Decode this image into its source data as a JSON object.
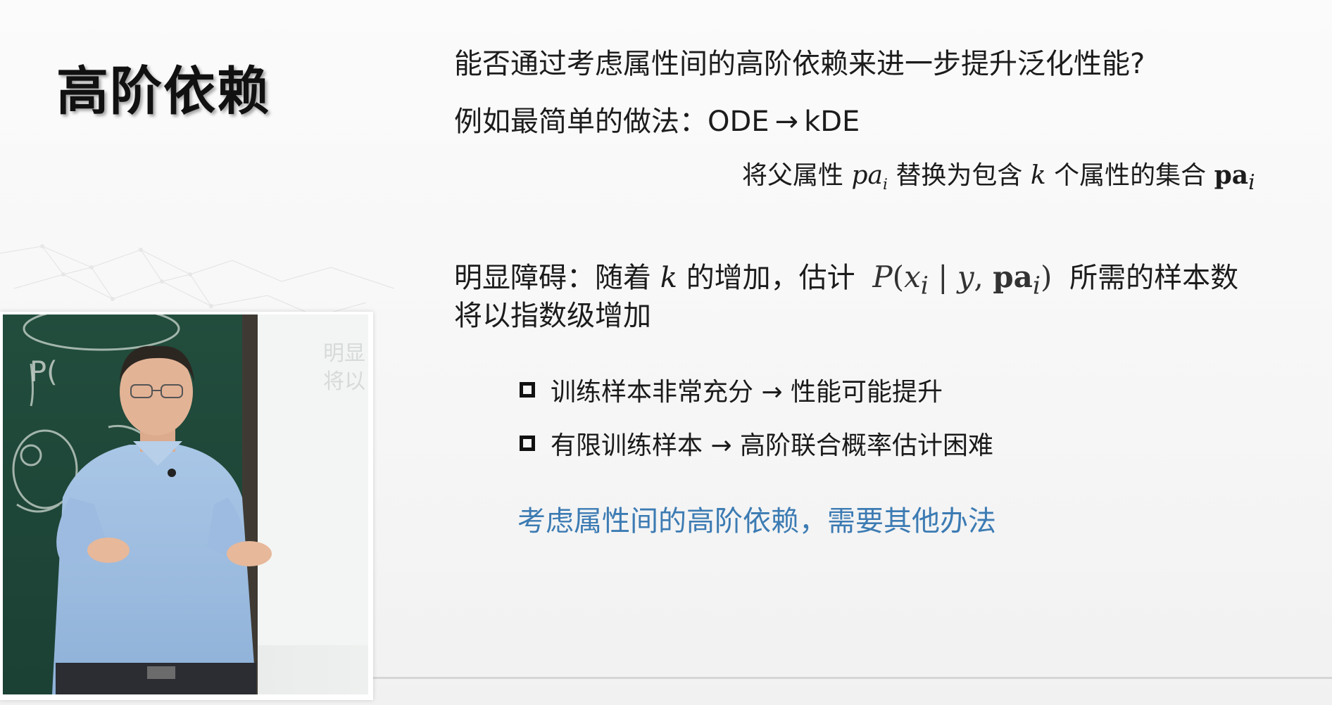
{
  "slide": {
    "title": "高阶依赖",
    "question": "能否通过考虑属性间的高阶依赖来进一步提升泛化性能?",
    "example": {
      "prefix": "例如最简单的做法：",
      "from": "ODE",
      "arrow": "→",
      "to": "kDE"
    },
    "substitution": {
      "part1": "将父属性",
      "var_pa": "pa",
      "sub_i": "i",
      "part2": "替换为包含",
      "var_k": "k",
      "part3": "个属性的集合",
      "var_pa_bold": "pa"
    },
    "obstacle": {
      "part1": "明显障碍：随着",
      "var_k": "k",
      "part2": "的增加，估计",
      "part3": "所需的样本数",
      "line2": "将以指数级增加"
    },
    "formula": {
      "P": "P",
      "open": "(",
      "x": "x",
      "sub_i": "i",
      "bar": " | ",
      "y": "y",
      "comma": ", ",
      "pa": "pa",
      "close": ")"
    },
    "bullets": [
      {
        "text": "训练样本非常充分 → 性能可能提升"
      },
      {
        "text": "有限训练样本 → 高阶联合概率估计困难"
      }
    ],
    "conclusion": "考虑属性间的高阶依赖，需要其他办法",
    "colors": {
      "accent": "#3c7bb3",
      "text": "#1c1c1c",
      "board": "#1f4a3a"
    }
  },
  "video": {
    "board_text": [
      "P(",
      "明显",
      "将以"
    ]
  }
}
